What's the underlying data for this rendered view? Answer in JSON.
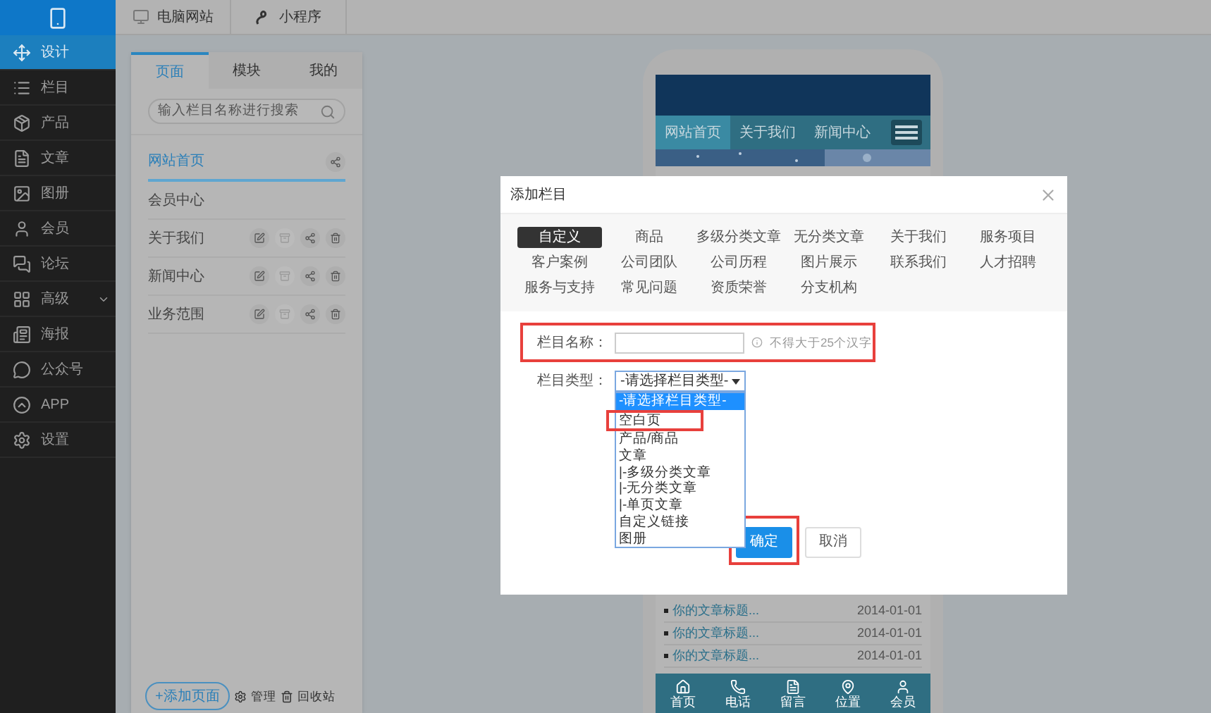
{
  "sidebar": {
    "items": [
      {
        "label": "设计",
        "selected": true
      },
      {
        "label": "栏目",
        "selected": false
      },
      {
        "label": "产品",
        "selected": false
      },
      {
        "label": "文章",
        "selected": false
      },
      {
        "label": "图册",
        "selected": false
      },
      {
        "label": "会员",
        "selected": false
      },
      {
        "label": "论坛",
        "selected": false
      },
      {
        "label": "高级",
        "selected": false,
        "expandable": true
      },
      {
        "label": "海报",
        "selected": false
      },
      {
        "label": "公众号",
        "selected": false
      },
      {
        "label": "APP",
        "selected": false
      },
      {
        "label": "设置",
        "selected": false
      }
    ]
  },
  "top_tabs": [
    {
      "label": "电脑网站"
    },
    {
      "label": "小程序"
    }
  ],
  "panel": {
    "tabs": [
      {
        "label": "页面",
        "selected": true
      },
      {
        "label": "模块",
        "selected": false
      },
      {
        "label": "我的",
        "selected": false
      }
    ],
    "search": {
      "placeholder": "输入栏目名称进行搜索"
    },
    "pages": [
      {
        "label": "网站首页",
        "selected": true,
        "kind": "home"
      },
      {
        "label": "会员中心",
        "selected": false,
        "kind": "fixed"
      },
      {
        "label": "关于我们",
        "selected": false,
        "kind": "editable"
      },
      {
        "label": "新闻中心",
        "selected": false,
        "kind": "editable"
      },
      {
        "label": "业务范围",
        "selected": false,
        "kind": "editable"
      }
    ],
    "add_button": "+添加页面",
    "manage": "管理",
    "recycle": "回收站"
  },
  "preview": {
    "nav": [
      {
        "label": "网站首页",
        "selected": true
      },
      {
        "label": "关于我们",
        "selected": false
      },
      {
        "label": "新闻中心",
        "selected": false
      }
    ],
    "articles": [
      {
        "title": "你的文章标题...",
        "date": "2014-01-01"
      },
      {
        "title": "你的文章标题...",
        "date": "2014-01-01"
      },
      {
        "title": "你的文章标题...",
        "date": "2014-01-01"
      }
    ],
    "bottom_nav": [
      "首页",
      "电话",
      "留言",
      "位置",
      "会员"
    ]
  },
  "dialog": {
    "title": "添加栏目",
    "presets": [
      {
        "label": "自定义",
        "selected": true
      },
      {
        "label": "商品",
        "selected": false
      },
      {
        "label": "多级分类文章",
        "selected": false
      },
      {
        "label": "无分类文章",
        "selected": false
      },
      {
        "label": "关于我们",
        "selected": false
      },
      {
        "label": "服务项目",
        "selected": false
      },
      {
        "label": "客户案例",
        "selected": false
      },
      {
        "label": "公司团队",
        "selected": false
      },
      {
        "label": "公司历程",
        "selected": false
      },
      {
        "label": "图片展示",
        "selected": false
      },
      {
        "label": "联系我们",
        "selected": false
      },
      {
        "label": "人才招聘",
        "selected": false
      },
      {
        "label": "服务与支持",
        "selected": false
      },
      {
        "label": "常见问题",
        "selected": false
      },
      {
        "label": "资质荣誉",
        "selected": false
      },
      {
        "label": "分支机构",
        "selected": false
      }
    ],
    "name_label": "栏目名称：",
    "name_hint": "不得大于25个汉字",
    "type_label": "栏目类型：",
    "type_value": "-请选择栏目类型-",
    "type_options": [
      {
        "label": "-请选择栏目类型-",
        "selected": true,
        "highlighted": false
      },
      {
        "label": "空白页",
        "selected": false,
        "highlighted": true
      },
      {
        "label": "产品/商品",
        "selected": false,
        "highlighted": false
      },
      {
        "label": "文章",
        "selected": false,
        "highlighted": false
      },
      {
        "label": "|-多级分类文章",
        "selected": false,
        "highlighted": false
      },
      {
        "label": "|-无分类文章",
        "selected": false,
        "highlighted": false
      },
      {
        "label": "|-单页文章",
        "selected": false,
        "highlighted": false
      },
      {
        "label": "自定义链接",
        "selected": false,
        "highlighted": false
      },
      {
        "label": "图册",
        "selected": false,
        "highlighted": false
      }
    ],
    "buttons": [
      {
        "label": "确定",
        "kind": "primary",
        "highlighted": true
      },
      {
        "label": "取消",
        "kind": "default",
        "highlighted": false
      }
    ]
  }
}
